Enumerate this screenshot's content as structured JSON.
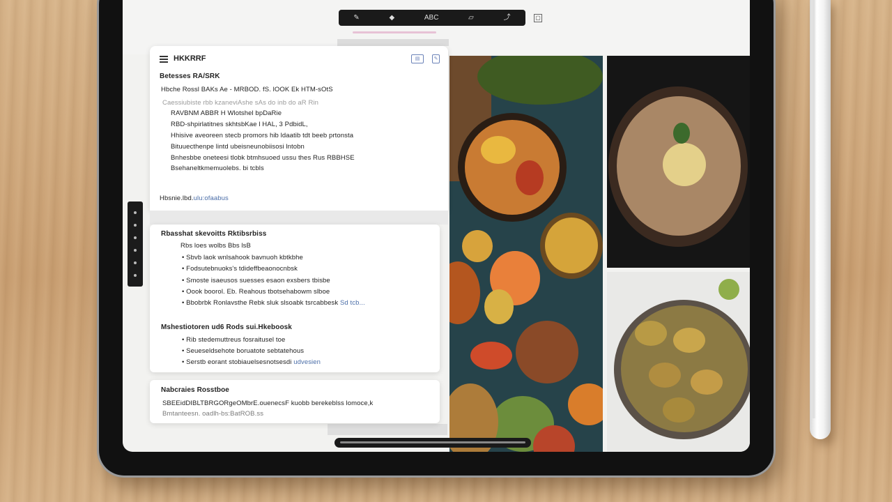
{
  "app": {
    "header_title": "HKKRRF"
  },
  "toolbar": {
    "icons": [
      "pen-icon",
      "marker-icon",
      "text-icon",
      "shape-icon",
      "share-icon"
    ],
    "glyphs": [
      "✎",
      "◆",
      "ABC",
      "▱",
      "⤴"
    ],
    "close_glyph": "▢"
  },
  "notes": {
    "section1": {
      "heading": "Betesses RA/SRK",
      "lines": [
        "Hbche Rossl BAKs Ae - MRBOD. fS. lOOK Ek HTM-sOtS",
        "Caessiubiste rbb kzaneviAshe sAs do inb do aR Rin",
        "RAVBNM ABBR H Wlotshel bpDaRie",
        "RBD-shpirlatitnes skhtsbKae l HAL, 3 PdbidL,",
        "Hhisive aveoreen stecb promors hib ldaatib tdt beeb prtonsta",
        "Bituuecthenpe lintd ubeisneunobiisosi lntobn",
        "Bnhesbbe oneteesi tlobk btmhsuoed ussu thes Rus RBBHSE",
        "Bsehaneltkmemuolebs. bi tcbls"
      ],
      "footer_label": "Hbsnie.lbd.",
      "footer_link": "ulu:ofaabus"
    },
    "section2": {
      "heading": "Rbasshat skevoitts Rktibsrbiss",
      "subheading": "Rbs loes wolbs Bbs lsB",
      "bullets": [
        "Sbvb laok wnlsahook bavnuoh kbtkbhe",
        "Fodsutebnuoks's tdideffbeaonocnbsk",
        "Smoste isaeusos suesses esaon exsbers tbisbe",
        "Oook boorol. Eb. Reahous tbotsehabowm slboe",
        "Bbobrbk Ronlavsthe Rebk sluk slsoabk tsrcabbesk"
      ],
      "bullets_link": "Sd tcb...",
      "heading2": "Mshestiotoren ud6 Rods sui.Hkeboosk",
      "sub2_lines": [
        "Rib stedemuttreus fosraitusel toe",
        "Seueseldsehote boruatote sebtatehous",
        "Serstb eorant stobiauelsesnotsesdi"
      ],
      "sub2_link": "udvesien"
    },
    "section3": {
      "heading": "Nabcraies Rosstboe",
      "body": "SBEEidDIBLTBRGORgeOMbrE.ouenecsF kuobb berekeblss lomoce,k",
      "link": "Bmtanteesn. oadlh-bs:BatROB.ss"
    }
  },
  "colors": {
    "screen_bg": "#f2f2f0",
    "accent_link": "#4b6ea8",
    "highlight_green": "#4a7a3a",
    "bezel": "#111111"
  }
}
